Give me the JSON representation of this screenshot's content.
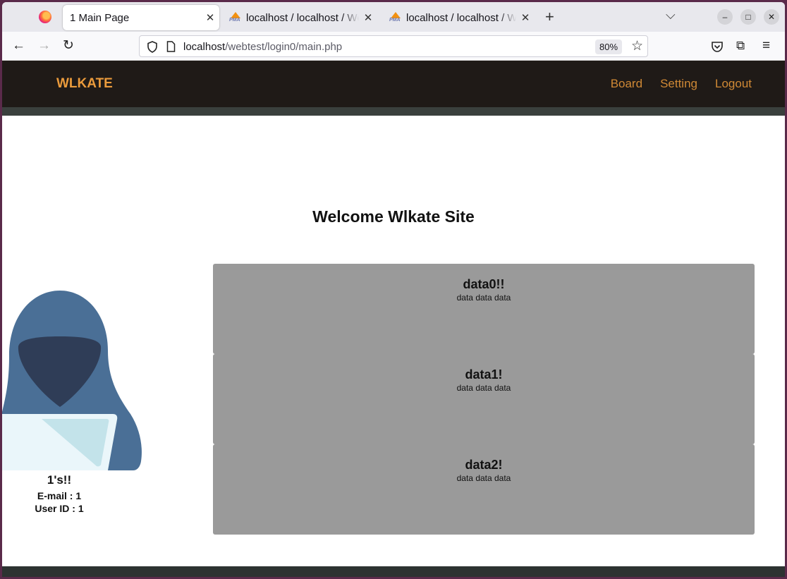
{
  "browser": {
    "tabs": [
      {
        "title": "1 Main Page",
        "active": true
      },
      {
        "title": "localhost / localhost / We",
        "active": false,
        "favicon": "phpmyadmin-icon",
        "favicon_text": "PMA"
      },
      {
        "title": "localhost / localhost / We",
        "active": false,
        "favicon": "phpmyadmin-icon",
        "favicon_text": "PMA"
      }
    ],
    "url_host": "localhost",
    "url_path": "/webtest/login0/main.php",
    "zoom": "80%"
  },
  "site": {
    "brand": "WLKATE",
    "menu": [
      "Board",
      "Setting",
      "Logout"
    ],
    "welcome": "Welcome Wlkate Site",
    "profile": {
      "name": "1's!!",
      "email": "E-mail : 1",
      "user_id": "User ID : 1"
    },
    "cards": [
      {
        "title": "data0!!",
        "text": "data data data"
      },
      {
        "title": "data1!",
        "text": "data data data"
      },
      {
        "title": "data2!",
        "text": "data data data"
      }
    ]
  },
  "colors": {
    "header_bg": "#1f1a17",
    "brand": "#eb9b3c",
    "menu": "#d08935",
    "card_bg": "#9a9a9a"
  }
}
